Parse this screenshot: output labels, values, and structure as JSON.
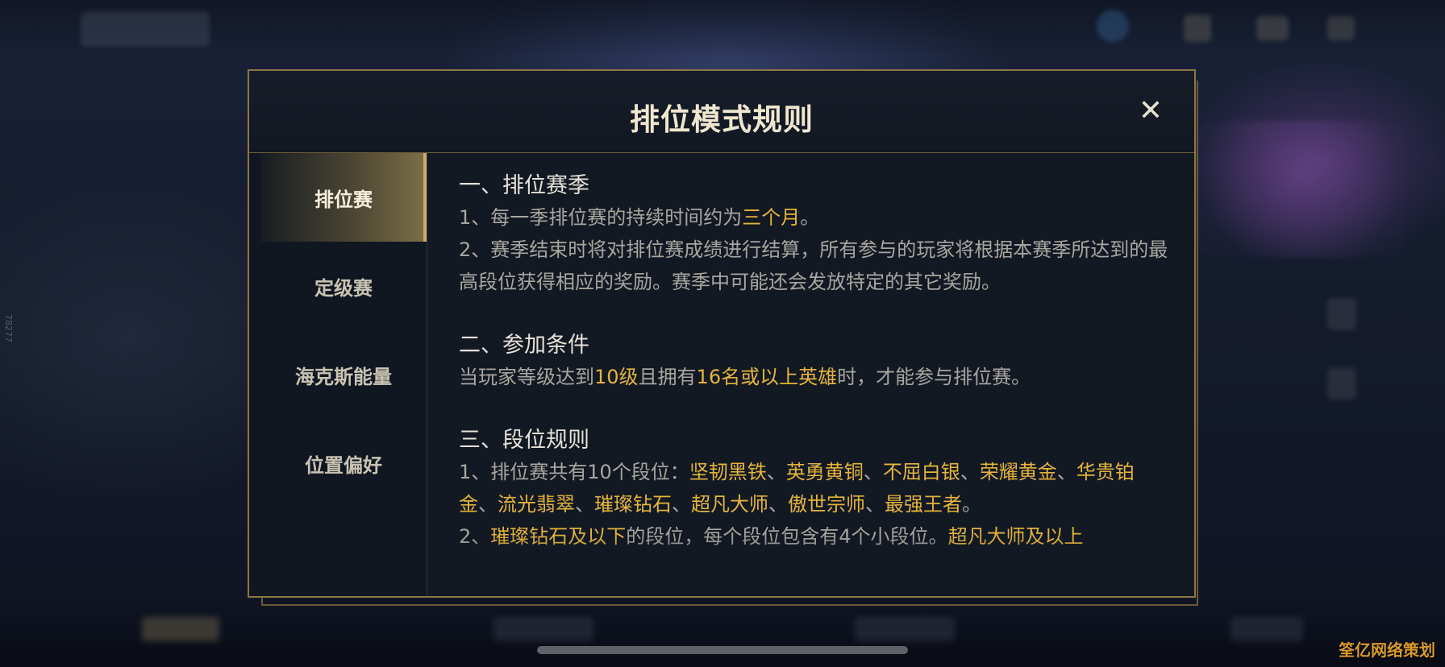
{
  "modal": {
    "title": "排位模式规则",
    "close_glyph": "✕"
  },
  "tabs": [
    {
      "label": "排位赛",
      "active": true
    },
    {
      "label": "定级赛",
      "active": false
    },
    {
      "label": "海克斯能量",
      "active": false
    },
    {
      "label": "位置偏好",
      "active": false
    }
  ],
  "content": {
    "s1": {
      "title": "一、排位赛季",
      "p1": {
        "a": "1、每一季排位赛的持续时间约为",
        "hl": "三个月",
        "b": "。"
      },
      "p2": "2、赛季结束时将对排位赛成绩进行结算，所有参与的玩家将根据本赛季所达到的最高段位获得相应的奖励。赛季中可能还会发放特定的其它奖励。"
    },
    "s2": {
      "title": "二、参加条件",
      "p1": {
        "a": "当玩家等级达到",
        "hl1": "10级",
        "b": "且拥有",
        "hl2": "16名或以上英雄",
        "c": "时，才能参与排位赛。"
      }
    },
    "s3": {
      "title": "三、段位规则",
      "p1": {
        "a": "1、排位赛共有10个段位：",
        "ranks": [
          "坚韧黑铁",
          "英勇黄铜",
          "不屈白银",
          "荣耀黄金",
          "华贵铂金",
          "流光翡翠",
          "璀璨钻石",
          "超凡大师",
          "傲世宗师",
          "最强王者"
        ],
        "sep": "、",
        "end": "。"
      },
      "p2": {
        "a": "2、",
        "hl1": "璀璨钻石及以下",
        "b": "的段位，每个段位包含有4个小段位。",
        "hl2": "超凡大师及以上"
      }
    }
  },
  "side_code": "78277",
  "watermark": "筌亿网络策划",
  "colors": {
    "accent": "#e5b43a",
    "frame": "#8d7646",
    "panel": "#131923"
  }
}
